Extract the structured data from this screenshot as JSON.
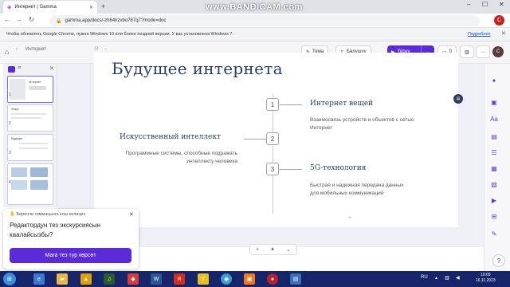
{
  "browser": {
    "tab_title": "Интернет | Gamma",
    "url": "gamma.app/docs/-zh64irzvbo787q7?mode=doc",
    "profile_initial": "C",
    "infobar_text": "Чтобы обновлять Google Chrome, нужна Windows 10 или более поздней версии. У вас установлена Windows 7.",
    "infobar_link": "Подробнее",
    "watermark": "www.BANDICAM.com"
  },
  "app": {
    "breadcrumb": "Интернет",
    "toolbar": {
      "theme": "Тема",
      "share": "Бөлүшүү",
      "present": "Үйрүү",
      "comments": "0"
    }
  },
  "slide": {
    "title": "Будущее интернета",
    "items": [
      {
        "num": "1",
        "heading": "Интернет вещей",
        "text": "Взаимосвязь устройств и объектов с сетью Интернет"
      },
      {
        "num": "2",
        "heading": "Искусственный интеллект",
        "text": "Программные системы, способные подражать интеллекту человека"
      },
      {
        "num": "3",
        "heading": "5G-технология",
        "text": "Быстрая и надежная передача данных для мобильных коммуникаций"
      }
    ]
  },
  "thumbnails": [
    "1",
    "2",
    "3",
    "4"
  ],
  "popup": {
    "intro": "Биринчи гаммаңызга кош келиңиз",
    "question": "Редактордун тез экскурсиясын каалайсызбы?",
    "button": "Мага тез тур көрсөт"
  },
  "taskbar": {
    "time": "19:09",
    "date": "16.11.2023",
    "lang": "RU"
  },
  "colors": {
    "accent": "#5b2bd9",
    "title": "#2c3e5a",
    "taskbar": "#16246a"
  }
}
